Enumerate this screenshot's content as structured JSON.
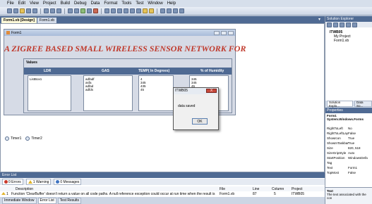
{
  "menu": [
    "File",
    "Edit",
    "View",
    "Project",
    "Build",
    "Debug",
    "Data",
    "Format",
    "Tools",
    "Test",
    "Window",
    "Help"
  ],
  "doc_tabs": [
    {
      "label": "Form1.vb [Design]",
      "active": true
    },
    {
      "label": "Form1.vb",
      "active": false
    }
  ],
  "doc_close": "▾ ✕",
  "form": {
    "title": "Form1",
    "heading": "A ZIGREE BASED SMALL WIRELESS SENSOR NETWORK FOR",
    "values_label": "Values",
    "columns": [
      "LDR",
      "GAS",
      "TEMP( In Degrees)",
      "% of Humidity"
    ],
    "listbox_label": "ListBox1",
    "gas_values": "adfadf\nasfa\nadfad\nadfds",
    "temp_values": "4\n345\n435\n45",
    "humidity_values": "345\n345\n45",
    "timers": [
      "Timer1",
      "Timer2"
    ]
  },
  "dialog": {
    "title": "ITWB05",
    "message": "data saved",
    "ok_label": "OK",
    "close_label": "X"
  },
  "error_list": {
    "title": "Error List",
    "tabs": [
      "0 Errors",
      "1 Warning",
      "0 Messages"
    ],
    "headers": [
      "Description",
      "File",
      "Line",
      "Column",
      "Project"
    ],
    "row": {
      "index": "1",
      "description": "Function 'ClearBuffer' doesn't return a value on all code paths. A null reference exception could occur at run time when the result is used.",
      "file": "Form1.vb",
      "line": "87",
      "column": "5",
      "project": "ITWB05"
    }
  },
  "bottom_tabs": [
    "Immediate Window",
    "Error List",
    "Test Results"
  ],
  "solution_explorer": {
    "title": "Solution Explorer",
    "items": [
      "ITWB05",
      "My Project",
      "Form1.vb"
    ],
    "tabs": [
      "Solution Explo...",
      "Data So..."
    ]
  },
  "properties": {
    "title": "Properties",
    "object": "Form1 System.Windows.Forms",
    "rows": [
      {
        "k": "RightToLeft",
        "v": "No"
      },
      {
        "k": "RightToLeftLay",
        "v": "False"
      },
      {
        "k": "ShowIcon",
        "v": "True"
      },
      {
        "k": "ShowInTaskbar",
        "v": "True"
      },
      {
        "k": "Size",
        "v": "820, 518"
      },
      {
        "k": "SizeGripStyle",
        "v": "Auto"
      },
      {
        "k": "StartPosition",
        "v": "WindowsDefa"
      },
      {
        "k": "Tag",
        "v": ""
      },
      {
        "k": "Text",
        "v": "Form1"
      },
      {
        "k": "TopMost",
        "v": "False"
      }
    ],
    "desc_title": "Text",
    "desc_text": "The text associated with the con"
  }
}
